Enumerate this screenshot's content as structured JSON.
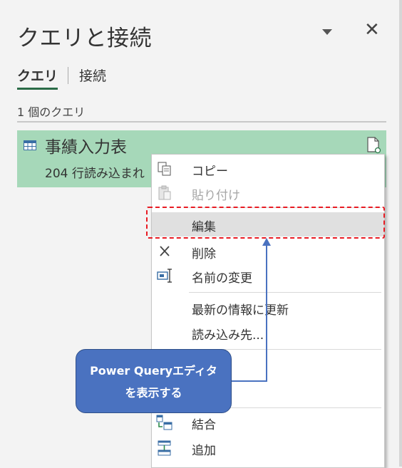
{
  "pane": {
    "title": "クエリと接続",
    "tabs": [
      {
        "label": "クエリ",
        "active": true
      },
      {
        "label": "接続",
        "active": false
      }
    ],
    "count_label": "1 個のクエリ"
  },
  "query": {
    "name": "事績入力表",
    "status": "204 行読み込まれ"
  },
  "context_menu": {
    "items": [
      {
        "label": "コピー",
        "icon": "copy-icon",
        "enabled": true
      },
      {
        "label": "貼り付け",
        "icon": "paste-icon",
        "enabled": false
      },
      {
        "label": "編集",
        "icon": "",
        "enabled": true,
        "highlighted": true
      },
      {
        "label": "削除",
        "icon": "delete-x-icon",
        "enabled": true
      },
      {
        "label": "名前の変更",
        "icon": "rename-icon",
        "enabled": true
      },
      {
        "label": "最新の情報に更新",
        "icon": "",
        "enabled": true
      },
      {
        "label": "読み込み先...",
        "icon": "",
        "enabled": true
      },
      {
        "label": "結合",
        "icon": "merge-icon",
        "enabled": true
      },
      {
        "label": "追加",
        "icon": "append-icon",
        "enabled": true
      }
    ]
  },
  "callout": {
    "line1": "Power Queryエディタ",
    "line2": "を表示する"
  },
  "colors": {
    "selected_query_bg": "#a6d8b9",
    "tab_underline": "#2b6b47",
    "highlight_dash": "#e81b23",
    "callout_bg": "#4a72c0"
  }
}
